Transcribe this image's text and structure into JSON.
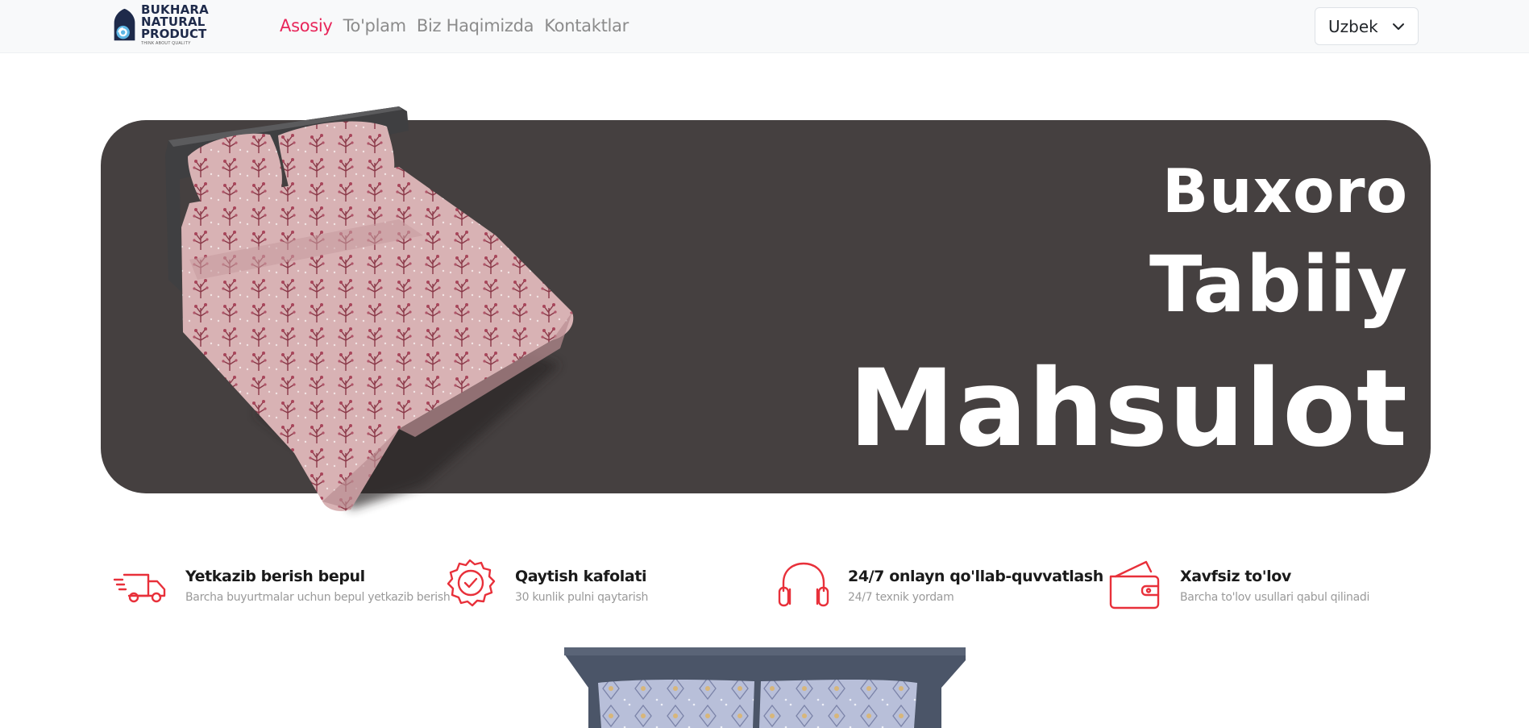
{
  "brand": {
    "line1": "BUKHARA NATURAL",
    "line2": "PRODUCT",
    "tagline": "THINK ABOUT QUALITY"
  },
  "nav": {
    "items": [
      {
        "label": "Asosiy",
        "active": true
      },
      {
        "label": "To'plam",
        "active": false
      },
      {
        "label": "Biz Haqimizda",
        "active": false
      },
      {
        "label": "Kontaktlar",
        "active": false
      }
    ]
  },
  "language": {
    "selected": "Uzbek"
  },
  "hero": {
    "line1": "Buxoro",
    "line2": "Tabiiy",
    "line3": "Mahsulot"
  },
  "features": [
    {
      "icon": "delivery-truck-icon",
      "title": "Yetkazib berish bepul",
      "subtitle": "Barcha buyurtmalar uchun bepul yetkazib berish"
    },
    {
      "icon": "quality-badge-icon",
      "title": "Qaytish kafolati",
      "subtitle": "30 kunlik pulni qaytarish"
    },
    {
      "icon": "headphones-icon",
      "title": "24/7 onlayn qo'llab-quvvatlash",
      "subtitle": "24/7 texnik yordam"
    },
    {
      "icon": "wallet-icon",
      "title": "Xavfsiz to'lov",
      "subtitle": "Barcha to'lov usullari qabul qilinadi"
    }
  ],
  "colors": {
    "accent": "#e8265a",
    "nav_text": "#8c8c8c",
    "hero_bg": "#454040",
    "icon_red": "#e8303a"
  }
}
